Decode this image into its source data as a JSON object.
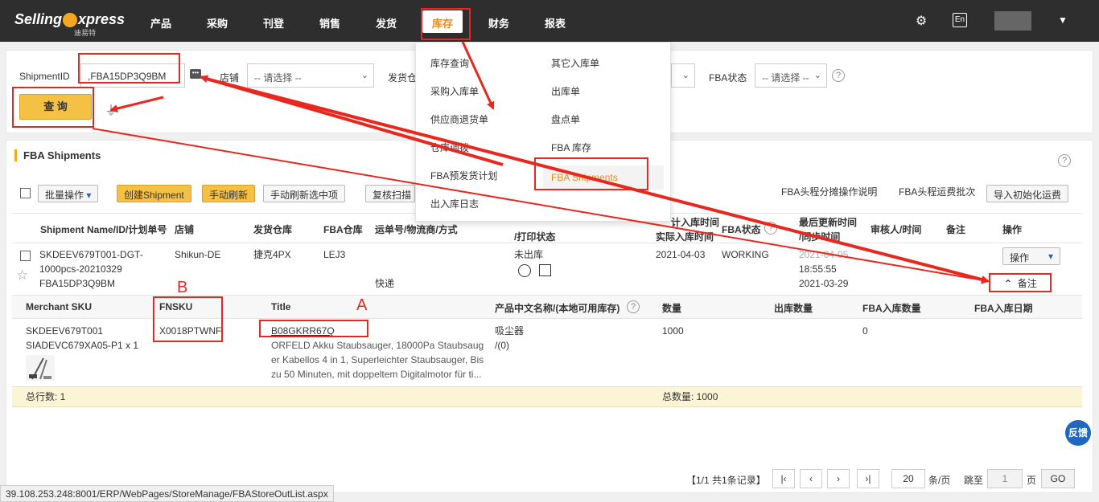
{
  "app": {
    "logo_text": "Selling express",
    "logo_sub": "迪易特"
  },
  "nav": {
    "items": [
      "产品",
      "采购",
      "刊登",
      "销售",
      "发货",
      "库存",
      "财务",
      "报表"
    ]
  },
  "filters": {
    "shipment_id_label": "ShipmentID",
    "shipment_id_value": ",FBA15DP3Q9BM",
    "store_label": "店铺",
    "store_select": "-- 请选择 --",
    "warehouse_label": "发货仓",
    "fba_status_label": "FBA状态",
    "fba_status_select": "-- 请选择 --",
    "query_button": "查 询"
  },
  "panel": {
    "title": "FBA Shipments",
    "toolbar": {
      "batch": "批量操作",
      "create": "创建Shipment",
      "manual_refresh": "手动刷新",
      "manual_refresh_selected": "手动刷新选中项",
      "rescan": "复核扫描",
      "link_cost_desc": "FBA头程分摊操作说明",
      "link_batch": "FBA头程运费批次",
      "import_freight": "导入初始化运费"
    },
    "columns": {
      "name": "Shipment Name/ID/计划单号",
      "store": "店铺",
      "warehouse": "发货仓库",
      "fba_warehouse": "FBA仓库",
      "tracking": "运单号/物流商/方式",
      "print": "/打印状态",
      "date_partial": "计入库时间",
      "date_actual": "实际入库时间",
      "fba_status": "FBA状态",
      "updated": "最后更新时间",
      "synced": "/同步时间",
      "reviewer": "审核人/时间",
      "note": "备注",
      "action": "操作"
    },
    "row": {
      "name_line1": "SKDEEV679T001-DGT-",
      "name_line2": "1000pcs-20210329",
      "shipment_id": "FBA15DP3Q9BM",
      "store": "Shikun-DE",
      "warehouse": "捷克4PX",
      "fba_warehouse": "LEJ3",
      "carrier": "快递",
      "out_status": "未出库",
      "date": "2021-04-03",
      "fba_status": "WORKING",
      "updated_time": "18:55:55",
      "synced": "2021-03-29",
      "updated_partial": "2021-04-05",
      "action_button": "操作",
      "note_toggle": "备注"
    },
    "detail_columns": {
      "merchant_sku": "Merchant SKU",
      "fnsku": "FNSKU",
      "title": "Title",
      "cn_name": "产品中文名称/(本地可用库存)",
      "qty": "数量",
      "out_qty": "出库数量",
      "fba_in_qty": "FBA入库数量",
      "fba_in_date": "FBA入库日期"
    },
    "detail_row": {
      "merchant_sku": "SKDEEV679T001",
      "linked_sku": "SIADEVC679XA05-P1 x 1",
      "fnsku": "X0018PTWNF",
      "asin": "B08GKRR67Q",
      "title_lines": [
        "ORFELD Akku Staubsauger, 18000Pa Staubsaug",
        "er Kabellos 4 in 1, Superleichter Staubsauger, Bis",
        "zu 50 Minuten, mit doppeltem Digitalmotor für ti..."
      ],
      "cn_name": "吸尘器",
      "stock": "/(0)",
      "qty": "1000",
      "fba_in_qty": "0"
    },
    "totals": {
      "rows": "总行数: 1",
      "qty": "总数量: 1000"
    }
  },
  "menu": {
    "left": [
      "库存查询",
      "采购入库单",
      "供应商退货单",
      "仓库调拨",
      "FBA预发货计划",
      "出入库日志"
    ],
    "right": [
      "其它入库单",
      "出库单",
      "盘点单",
      "FBA 库存",
      "FBA Shipments"
    ]
  },
  "pagination": {
    "summary": "【1/1  共1条记录】",
    "page_size": "20",
    "per_page": "条/页",
    "jump": "跳至",
    "page_input": "1",
    "page_unit": "页",
    "go": "GO"
  },
  "status_url": "39.108.253.248:8001/ERP/WebPages/StoreManage/FBAStoreOutList.aspx",
  "feedback": "反馈",
  "annotations": {
    "a": "A",
    "b": "B"
  }
}
